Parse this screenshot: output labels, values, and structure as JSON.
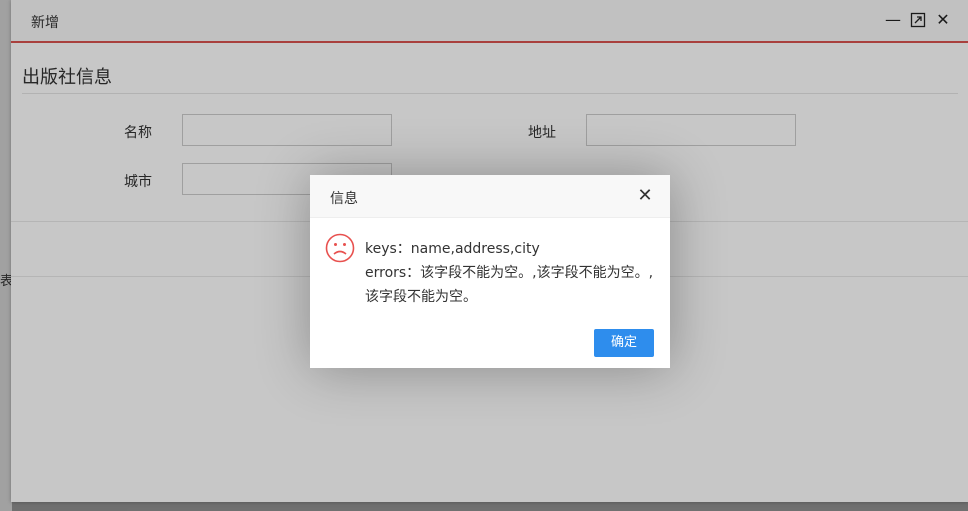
{
  "background": {
    "partial_text": "表i"
  },
  "window": {
    "title": "新增",
    "minimize_glyph": "—",
    "maximize_glyph": "⤢",
    "close_glyph": "✕"
  },
  "form": {
    "section_title": "出版社信息",
    "fields": [
      {
        "label": "名称",
        "value": ""
      },
      {
        "label": "地址",
        "value": ""
      },
      {
        "label": "城市",
        "value": ""
      }
    ]
  },
  "dialog": {
    "title": "信息",
    "close_glyph": "✕",
    "icon": "sad-face-icon",
    "icon_color": "#e8514f",
    "message_line1": "keys：name,address,city",
    "message_line2": "errors：该字段不能为空。,该字段不能为空。,",
    "message_line3": "该字段不能为空。",
    "confirm_label": "确定"
  },
  "colors": {
    "accent_border": "#d9534f",
    "primary_button": "#2e8ded"
  }
}
